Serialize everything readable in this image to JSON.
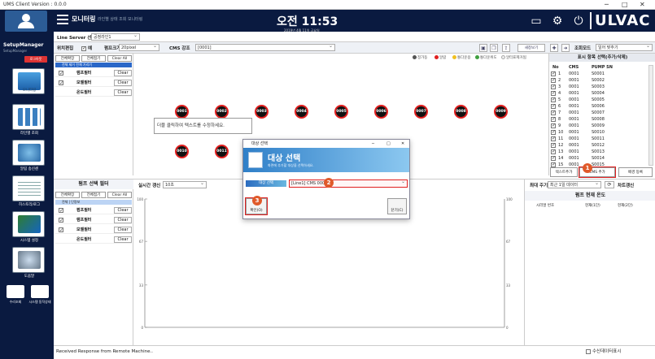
{
  "window": {
    "title": "UMS Client Version : 0.0.0",
    "controls": [
      "─",
      "□",
      "✕"
    ]
  },
  "header": {
    "menu_title": "모니터링",
    "menu_sub": "라인별 상태 조회 모니터링",
    "time": "오전 11:53",
    "date": "2019년 4월 11일 금요일",
    "brand": "ULVAC"
  },
  "sidebar": {
    "user": "SetupManager",
    "user_sub": "SetupManager",
    "logout": "로그아웃",
    "nav": [
      {
        "label": "모니터링"
      },
      {
        "label": "라인별 조회"
      },
      {
        "label": "알림 송신센"
      },
      {
        "label": "히스토리/로그"
      },
      {
        "label": "시스템 설정"
      },
      {
        "label": "도움말"
      }
    ],
    "small_nav": [
      {
        "label": "수리조회"
      },
      {
        "label": "시스템 동작상태"
      }
    ]
  },
  "linebar": {
    "label": "Line Server 선택",
    "value": "공정라인1"
  },
  "toolbar": {
    "edit_label": "위치편집",
    "edit_check": "예",
    "pump_size_label": "펌프크기",
    "pump_size_value": "20pixel",
    "cms_label": "CMS 강조",
    "cms_value": "[0001]",
    "new_label": "새창보기",
    "sort_label": "조회모드",
    "sort_value": "일어 맞추기"
  },
  "tree": {
    "btn_expand": "전체확장",
    "btn_collapse": "전체접기",
    "btn_clear": "Clear All",
    "top_item": "전체 제거 전체 가리기",
    "rows": [
      {
        "name": "램프필터",
        "clear": "Clear"
      },
      {
        "name": "모델필터",
        "clear": "Clear"
      },
      {
        "name": "온도필터",
        "clear": "Clear"
      }
    ]
  },
  "legend": [
    {
      "label": "정가동",
      "color": "#555555"
    },
    {
      "label": "알람",
      "color": "#e02020"
    },
    {
      "label": "통다운용",
      "color": "#f0c020"
    },
    {
      "label": "통다운위도",
      "color": "#40a040"
    },
    {
      "label": "알터표제거됨",
      "color": "#dddddd"
    }
  ],
  "pumps": [
    "0001",
    "0002",
    "0003",
    "0004",
    "0005",
    "0006",
    "0007",
    "0008",
    "0009",
    "0010",
    "0011"
  ],
  "tooltip": "더블 클릭하여 텍스트를 수정하세요.",
  "rpanel": {
    "title": "표시 항목 선택(추가/삭제)",
    "headers": [
      "No",
      "CMS",
      "PUMP SN"
    ],
    "rows": [
      [
        "1",
        "0001",
        "S0001"
      ],
      [
        "2",
        "0001",
        "S0002"
      ],
      [
        "3",
        "0001",
        "S0003"
      ],
      [
        "4",
        "0001",
        "S0004"
      ],
      [
        "5",
        "0001",
        "S0005"
      ],
      [
        "6",
        "0001",
        "S0006"
      ],
      [
        "7",
        "0001",
        "S0007"
      ],
      [
        "8",
        "0001",
        "S0008"
      ],
      [
        "9",
        "0001",
        "S0009"
      ],
      [
        "10",
        "0001",
        "S0010"
      ],
      [
        "11",
        "0001",
        "S0011"
      ],
      [
        "12",
        "0001",
        "S0012"
      ],
      [
        "13",
        "0001",
        "S0013"
      ],
      [
        "14",
        "0001",
        "S0014"
      ],
      [
        "15",
        "0001",
        "S0015"
      ]
    ],
    "btn_text_add": "텍스트추가",
    "btn_cms_add": "CMS 추가",
    "btn_bg": "배경 등록"
  },
  "filter_panel": {
    "title": "펌프 선택 필터",
    "btn_expand": "전체확장",
    "btn_collapse": "전체접기",
    "btn_clear": "Clear All",
    "top_item": "전체 | 단량보",
    "rows": [
      {
        "name": "펌프필터",
        "clear": "Clear"
      },
      {
        "name": "램프필터",
        "clear": "Clear"
      },
      {
        "name": "모델필터",
        "clear": "Clear"
      },
      {
        "name": "온도필터",
        "clear": "Clear"
      }
    ]
  },
  "chart_panel": {
    "label": "실시간 갱신",
    "value": "10초"
  },
  "chart_data": {
    "type": "line",
    "title": "",
    "xlabel": "",
    "ylabel": "",
    "ylim": [
      0,
      100
    ],
    "yticks_left": [
      "100",
      "67",
      "33",
      "0"
    ],
    "yticks_right": [
      "100",
      "67",
      "33",
      "0"
    ],
    "series": []
  },
  "right_chart": {
    "period_label": "최대 주기",
    "period_value": "최근 1일 데이터",
    "refresh_label": "차트갱신",
    "title": "펌프 현재 온도",
    "headers": [
      "시리얼 번호",
      "현재(1단)",
      "현재(2단)"
    ]
  },
  "status": {
    "message": "Received Response from Remote Machine..",
    "auto_update": "수신데이터표시"
  },
  "dialog": {
    "title": "대상 선택",
    "heading": "대상 선택",
    "subtitle": "화면에 추가할 대상을 선택하세요.",
    "field_label": "대상 선택",
    "field_value": "[Line1] CMS 0003",
    "ok": "확인(O)",
    "cancel": "닫기(C)",
    "badges": [
      "1",
      "2",
      "3"
    ]
  }
}
